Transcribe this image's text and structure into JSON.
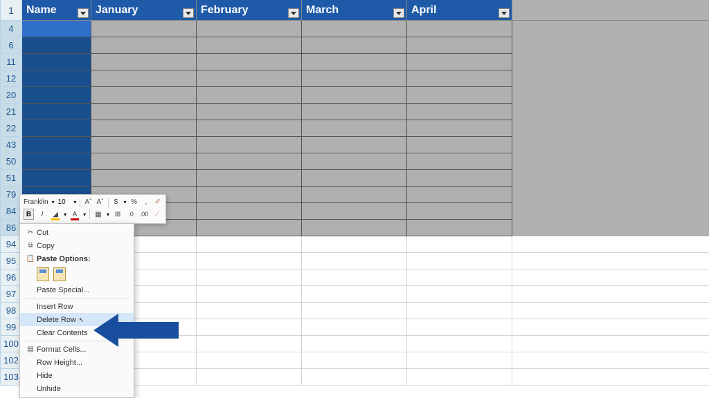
{
  "headers": {
    "name": "Name",
    "months": [
      "January",
      "February",
      "March",
      "April"
    ]
  },
  "row_numbers_selected": [
    "4",
    "6",
    "11",
    "12",
    "20",
    "21",
    "22",
    "43",
    "50",
    "51",
    "79",
    "84",
    "86"
  ],
  "row_numbers_plain": [
    "94",
    "95",
    "96",
    "97",
    "98",
    "99",
    "100",
    "102",
    "103"
  ],
  "header_row_number": "1",
  "mini_toolbar": {
    "font": "Franklin",
    "size": "10",
    "inc": "Aˆ",
    "dec": "Aˇ",
    "currency": "$",
    "percent": "%",
    "comma": ",",
    "bold": "B",
    "italic": "I",
    "font_color": "A",
    "fill_color": "A"
  },
  "context_menu": {
    "cut": "Cut",
    "copy": "Copy",
    "paste_options": "Paste Options:",
    "paste_special": "Paste Special...",
    "insert_row": "Insert Row",
    "delete_row": "Delete Row",
    "clear_contents": "Clear Contents",
    "format_cells": "Format Cells...",
    "row_height": "Row Height...",
    "hide": "Hide",
    "unhide": "Unhide"
  }
}
